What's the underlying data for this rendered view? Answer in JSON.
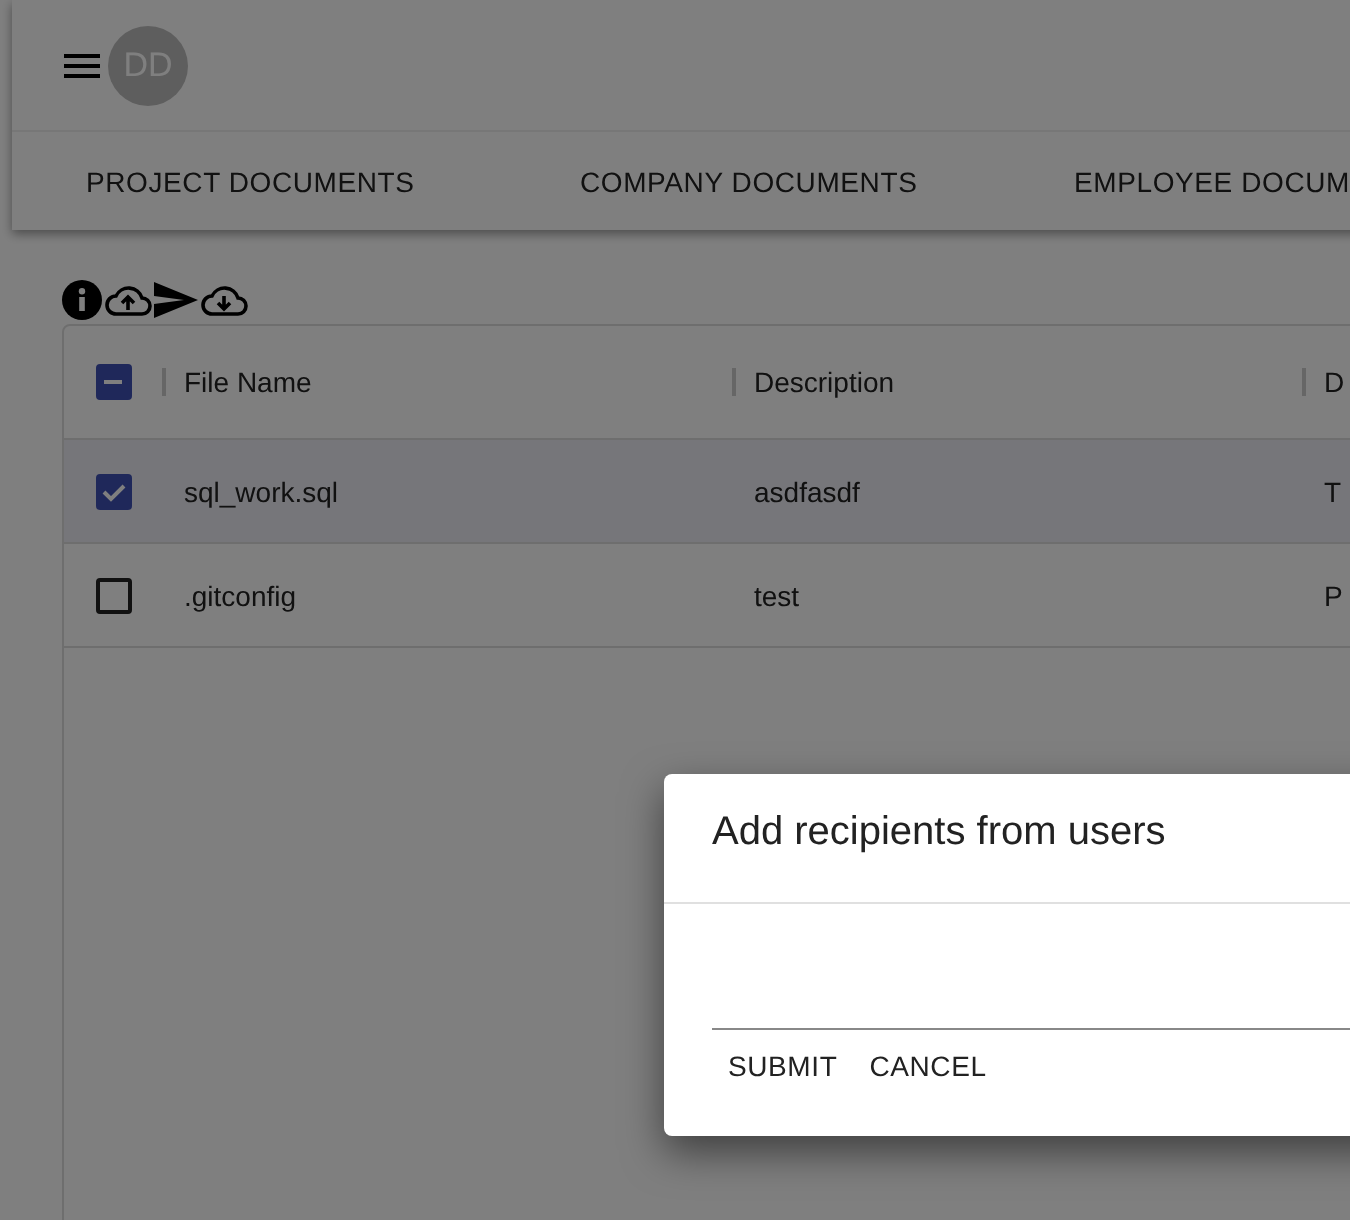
{
  "app_bar": {
    "avatar": "DD"
  },
  "tabs": [
    {
      "label": "PROJECT DOCUMENTS",
      "selected": false
    },
    {
      "label": "COMPANY DOCUMENTS",
      "selected": false
    },
    {
      "label": "EMPLOYEE DOCUM",
      "selected": false
    }
  ],
  "table": {
    "select_all": {
      "indeterminate": true
    },
    "columns": [
      "File Name",
      "Description",
      "D"
    ],
    "rows": [
      {
        "selected": true,
        "cells": [
          "sql_work.sql",
          "asdfasdf",
          "T"
        ]
      },
      {
        "selected": false,
        "cells": [
          ".gitconfig",
          "test",
          "P"
        ]
      }
    ]
  },
  "dialog": {
    "title": "Add recipients from users",
    "buttons": [
      "SUBMIT",
      "CANCEL"
    ]
  }
}
